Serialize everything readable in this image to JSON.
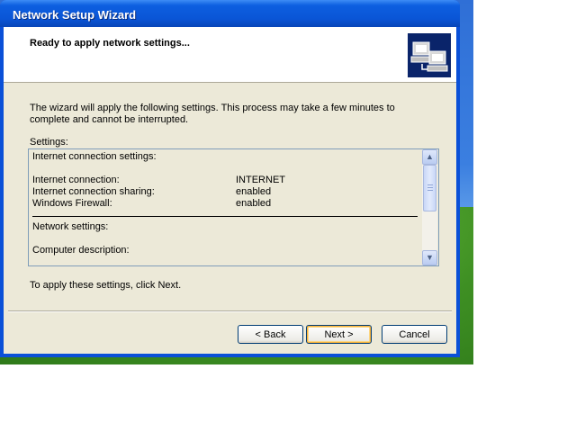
{
  "window": {
    "title": "Network Setup Wizard"
  },
  "header": {
    "title": "Ready to apply network settings...",
    "icon": "network-computers-icon"
  },
  "intro_text": "The wizard will apply the following settings. This process may take a few minutes to complete and cannot be interrupted.",
  "settings_label": "Settings:",
  "settings_list": {
    "section1": "Internet connection settings:",
    "rows": [
      {
        "label": "Internet connection:",
        "value": "INTERNET"
      },
      {
        "label": "Internet connection sharing:",
        "value": "enabled"
      },
      {
        "label": "Windows Firewall:",
        "value": "enabled"
      }
    ],
    "section2": "Network settings:",
    "computer_description": "Computer description:"
  },
  "apply_text": "To apply these settings, click Next.",
  "buttons": {
    "back": "< Back",
    "next": "Next >",
    "cancel": "Cancel"
  },
  "colors": {
    "title_bar": "#0a55d6",
    "client_bg": "#ece9d8",
    "listbox_border": "#7f9db9",
    "icon_bg": "#0a246a"
  }
}
